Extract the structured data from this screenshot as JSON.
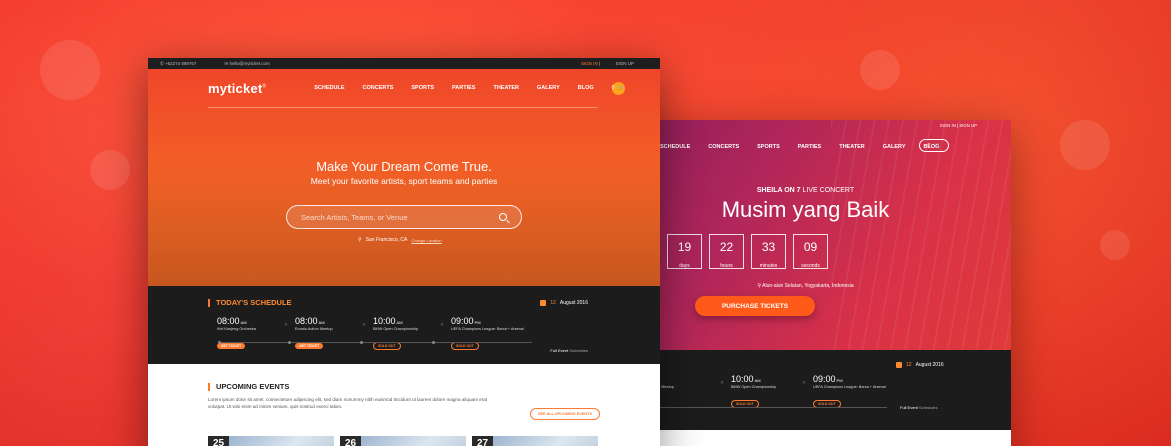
{
  "front": {
    "topbar": {
      "phone": "+62274 889767",
      "email": "hello@myticket.com",
      "sign_in": "SIGN IN",
      "divider": "|",
      "sign_up": "SIGN UP"
    },
    "logo": "myticket",
    "logo_mark": "®",
    "menu": [
      "SCHEDULE",
      "CONCERTS",
      "SPORTS",
      "PARTIES",
      "THEATER",
      "GALERY",
      "BLOG"
    ],
    "cart_count": "0",
    "hero": {
      "headline": "Make Your Dream Come True.",
      "subheadline": "Meet your favorite artists, sport teams and parties",
      "search_placeholder": "Search Artists, Teams, or Venue",
      "location": "San Francisco, CA",
      "change_location": "Change Location"
    },
    "schedule": {
      "title": "TODAY'S SCHEDULE",
      "date_day": "12",
      "date_rest": "August 2016",
      "events": [
        {
          "time": "08:00",
          "ampm": "AM",
          "name": "Kiel Kanjeng Orchestra",
          "action": "GET TICKET",
          "sold_out": false
        },
        {
          "time": "08:00",
          "ampm": "AM",
          "name": "Envato Author Meetup",
          "action": "GET TICKET",
          "sold_out": false
        },
        {
          "time": "10:00",
          "ampm": "AM",
          "name": "BMW Open Championship",
          "action": "SOLD OUT",
          "sold_out": true
        },
        {
          "time": "09:00",
          "ampm": "PM",
          "name": "UEFA Champions League: Barca + Arsenal",
          "action": "SOLD OUT",
          "sold_out": true
        }
      ],
      "full_label": "Full Event",
      "full_suffix": "Schedules"
    },
    "upcoming": {
      "title": "UPCOMING EVENTS",
      "description": "Lorem ipsum dolor sit amet, consectetuer adipiscing elit, sed diam nonummy nibh euismod tincidunt ut laoreet dolore magna aliquam erat volutpat. Ut wisi enim ad minim veniam, quis nostrud exerci tation.",
      "see_all": "SEE ALL UPCOMING EVENTS",
      "cards": [
        "25",
        "26",
        "27"
      ]
    }
  },
  "back": {
    "topbar": {
      "sign_in": "SIGN IN",
      "divider": "|",
      "sign_up": "SIGN UP"
    },
    "menu": [
      "SCHEDULE",
      "CONCERTS",
      "SPORTS",
      "PARTIES",
      "THEATER",
      "GALERY",
      "BLOG"
    ],
    "cart_count": "0",
    "hero": {
      "artist": "SHEILA ON 7",
      "event_type": "LIVE CONCERT",
      "title": "Musim yang Baik",
      "countdown": [
        {
          "value": "19",
          "unit": "days"
        },
        {
          "value": "22",
          "unit": "hours"
        },
        {
          "value": "33",
          "unit": "minutes"
        },
        {
          "value": "09",
          "unit": "seconds"
        }
      ],
      "location": "Alun-alun Selatan, Yogyakarta, Indonesia",
      "cta": "PURCHASE TICKETS"
    },
    "schedule": {
      "date_day": "12",
      "date_rest": "August 2016",
      "events": [
        {
          "time": "",
          "ampm": "",
          "name": "Author Meetup",
          "action": "",
          "sold_out": false
        },
        {
          "time": "10:00",
          "ampm": "AM",
          "name": "BMW Open Championship",
          "action": "SOLD OUT",
          "sold_out": true
        },
        {
          "time": "09:00",
          "ampm": "PM",
          "name": "UEFA Champions League: Barca + Arsenal",
          "action": "SOLD OUT",
          "sold_out": true
        }
      ],
      "full_label": "Full Event",
      "full_suffix": "Schedules"
    }
  },
  "colors": {
    "accent": "#ff7a30",
    "hero_orange": "#f36426",
    "hero_magenta": "#b0265a",
    "dark": "#1c1c1c"
  }
}
